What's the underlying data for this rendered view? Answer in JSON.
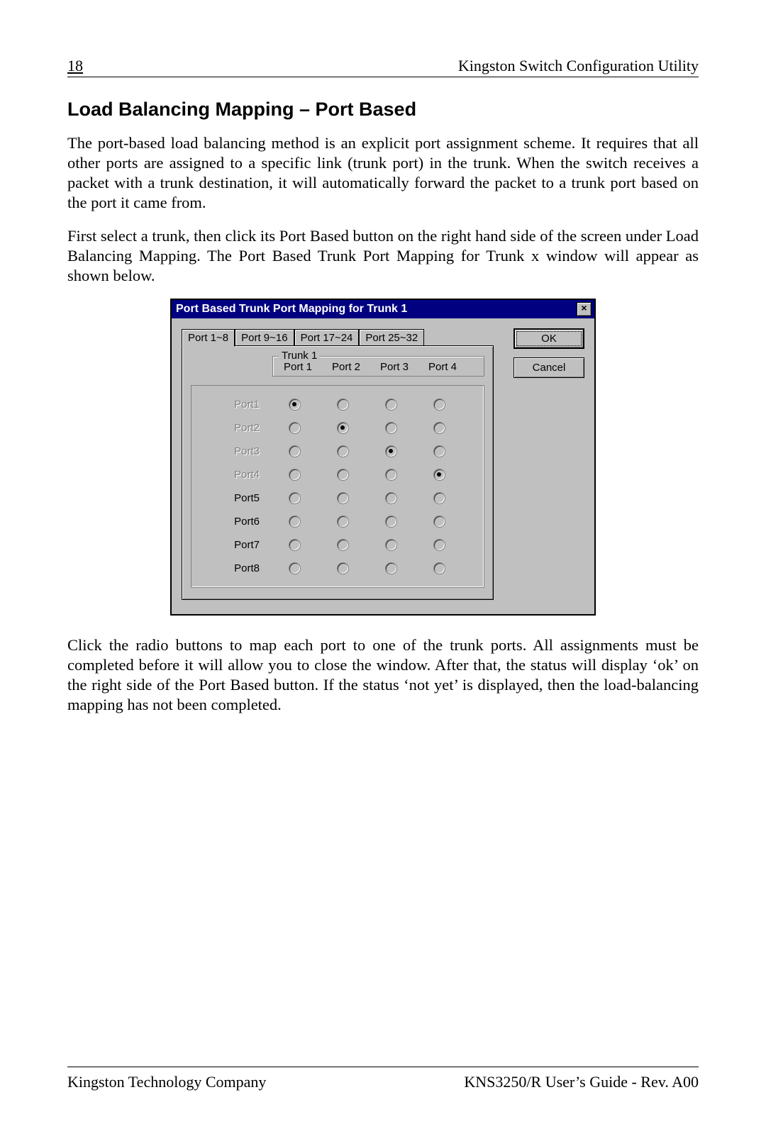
{
  "header": {
    "page_number": "18",
    "running_title": "Kingston Switch Configuration Utility"
  },
  "section_title": "Load Balancing Mapping – Port Based",
  "para1": "The port-based load balancing method is an explicit port assignment scheme. It requires that all other ports are assigned to a specific link (trunk port) in the trunk. When the switch receives a packet with a trunk destination, it will automatically forward the packet to a trunk port based on the port it came from.",
  "para2": "First select a trunk, then click its Port Based button on the right hand side of the screen under Load Balancing Mapping. The Port Based Trunk Port Mapping for Trunk x window will appear as shown below.",
  "dialog": {
    "title": "Port Based Trunk Port Mapping for Trunk 1",
    "close_glyph": "×",
    "tabs": [
      "Port 1~8",
      "Port 9~16",
      "Port 17~24",
      "Port 25~32"
    ],
    "active_tab": 0,
    "group_legend": "Trunk 1",
    "trunk_cols": [
      "Port 1",
      "Port 2",
      "Port 3",
      "Port 4"
    ],
    "row_labels": [
      "Port1",
      "Port2",
      "Port3",
      "Port4",
      "Port5",
      "Port6",
      "Port7",
      "Port8"
    ],
    "disabled_rows": [
      0,
      1,
      2,
      3
    ],
    "selections": {
      "Port1": 0,
      "Port2": 1,
      "Port3": 2,
      "Port4": 3,
      "Port5": null,
      "Port6": null,
      "Port7": null,
      "Port8": null
    },
    "ok_label": "OK",
    "cancel_label": "Cancel"
  },
  "para3": "Click the radio buttons to map each port to one of the trunk ports. All assignments must be completed before it will allow you to close the window. After that, the status will display ‘ok’ on the right side of the Port Based button. If the status ‘not yet’ is displayed, then the load-balancing mapping has not been completed.",
  "footer": {
    "left": "Kingston Technology Company",
    "right": "KNS3250/R User’s Guide - Rev. A00"
  }
}
